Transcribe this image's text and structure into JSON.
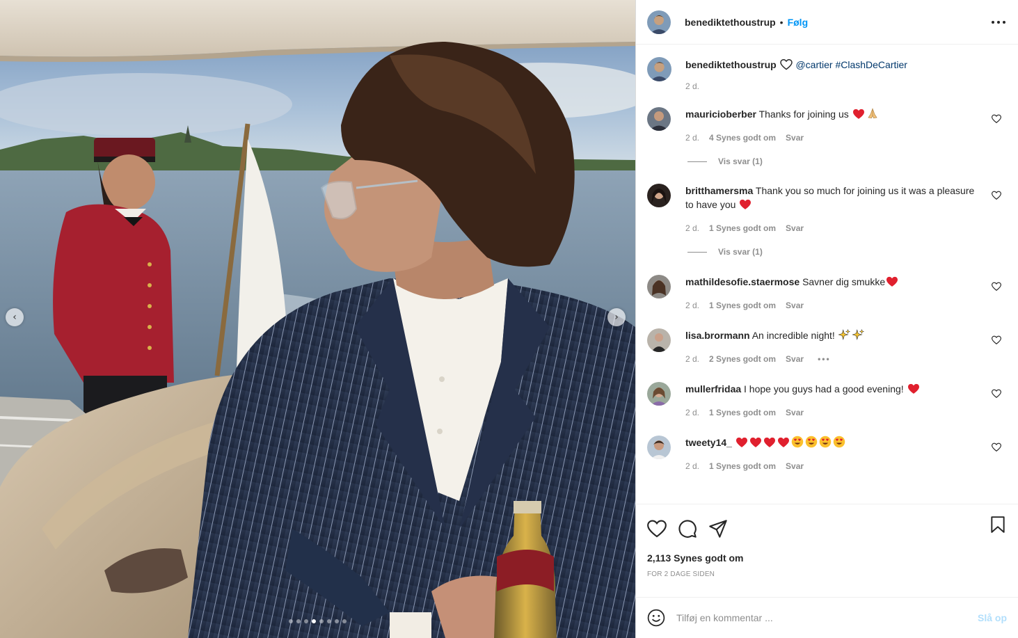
{
  "post": {
    "username": "benediktethoustrup",
    "follow_label": "Følg",
    "separator": "•",
    "caption_mention": "@cartier",
    "caption_hashtag": "#ClashDeCartier",
    "caption_time": "2 d."
  },
  "media": {
    "carousel_total": 8,
    "carousel_active_index": 3,
    "prev_icon": "chevron-left-icon",
    "next_icon": "chevron-right-icon"
  },
  "comments": [
    {
      "username": "mauricioberber",
      "text": "Thanks for joining us",
      "emoji_after": [
        "red-heart",
        "folded-hands"
      ],
      "time": "2 d.",
      "likes": "4 Synes godt om",
      "reply": "Svar",
      "view_replies": "Vis svar (1)"
    },
    {
      "username": "britthamersma",
      "text": "Thank you so much for joining us it was a pleasure to have you",
      "emoji_after": [
        "red-heart"
      ],
      "time": "2 d.",
      "likes": "1 Synes godt om",
      "reply": "Svar",
      "view_replies": "Vis svar (1)"
    },
    {
      "username": "mathildesofie.staermose",
      "text": "Savner dig smukke",
      "emoji_after": [
        "red-heart"
      ],
      "time": "2 d.",
      "likes": "1 Synes godt om",
      "reply": "Svar"
    },
    {
      "username": "lisa.brormann",
      "text": "An incredible night!",
      "emoji_after": [
        "sparkles",
        "sparkles"
      ],
      "time": "2 d.",
      "likes": "2 Synes godt om",
      "reply": "Svar",
      "more": "•••"
    },
    {
      "username": "mullerfridaa",
      "text": "I hope you guys had a good evening!",
      "emoji_after": [
        "red-heart"
      ],
      "time": "2 d.",
      "likes": "1 Synes godt om",
      "reply": "Svar"
    },
    {
      "username": "tweety14_",
      "text": "",
      "emoji_after": [
        "red-heart",
        "red-heart",
        "red-heart",
        "red-heart",
        "heart-eyes",
        "heart-eyes",
        "heart-eyes",
        "heart-eyes"
      ],
      "time": "2 d.",
      "likes": "1 Synes godt om",
      "reply": "Svar"
    }
  ],
  "footer": {
    "likes_count": "2,113 Synes godt om",
    "posted": "FOR 2 DAGE SIDEN",
    "comment_placeholder": "Tilføj en kommentar ...",
    "post_label": "Slå op"
  },
  "colors": {
    "link": "#00376b",
    "follow": "#0095f6",
    "muted": "#8e8e8e",
    "post_disabled": "#b2dffc"
  }
}
